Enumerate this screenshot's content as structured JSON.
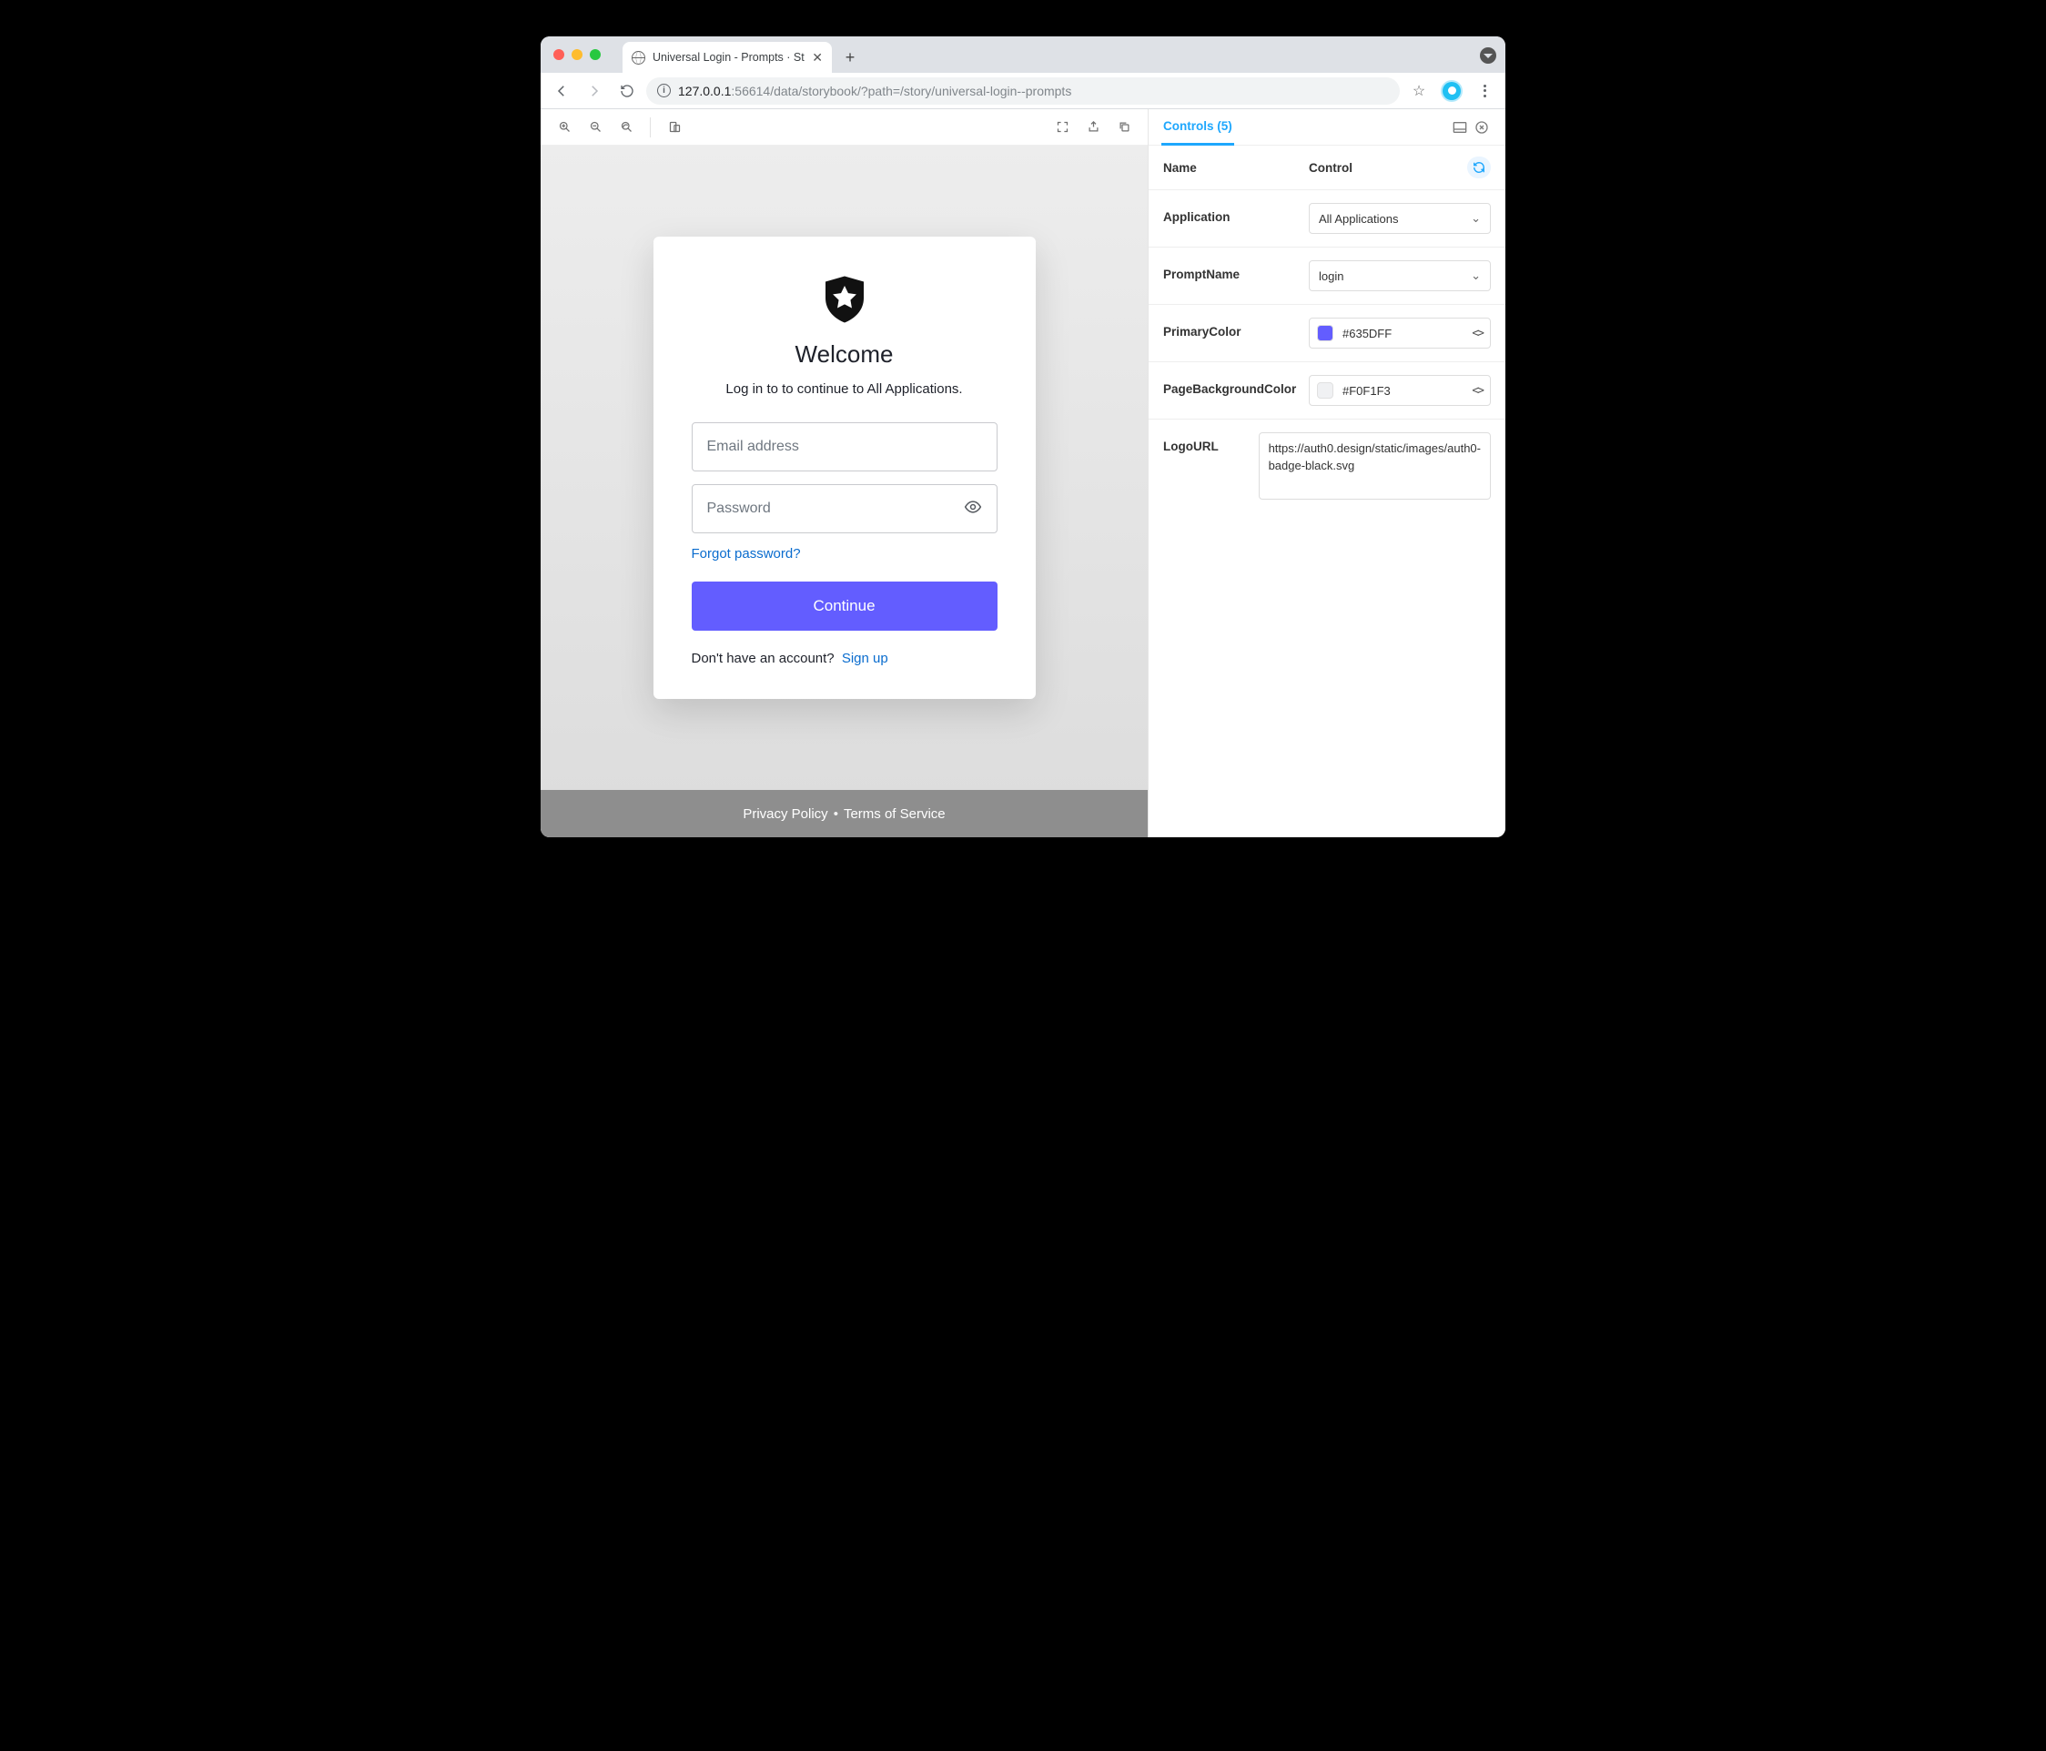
{
  "browser": {
    "tab_title": "Universal Login - Prompts · St",
    "url_display": {
      "host": "127.0.0.1",
      "port": ":56614",
      "path": "/data/storybook/?path=/story/universal-login--prompts"
    }
  },
  "panel": {
    "tab_label": "Controls (5)",
    "header": {
      "name": "Name",
      "control": "Control"
    },
    "rows": {
      "application": {
        "label": "Application",
        "value": "All Applications"
      },
      "promptName": {
        "label": "PromptName",
        "value": "login"
      },
      "primaryColor": {
        "label": "PrimaryColor",
        "value": "#635DFF"
      },
      "pageBg": {
        "label": "PageBackgroundColor",
        "value": "#F0F1F3"
      },
      "logoUrl": {
        "label": "LogoURL",
        "value": "https://auth0.design/static/images/auth0-badge-black.svg"
      }
    }
  },
  "login": {
    "title": "Welcome",
    "subtitle": "Log in to to continue to All Applications.",
    "email_placeholder": "Email address",
    "password_placeholder": "Password",
    "forgot": "Forgot password?",
    "continue": "Continue",
    "no_account": "Don't have an account?",
    "signup": "Sign up",
    "footer": {
      "privacy": "Privacy Policy",
      "terms": "Terms of Service"
    }
  },
  "colors": {
    "primary": "#635DFF",
    "pageBg": "#F0F1F3"
  }
}
